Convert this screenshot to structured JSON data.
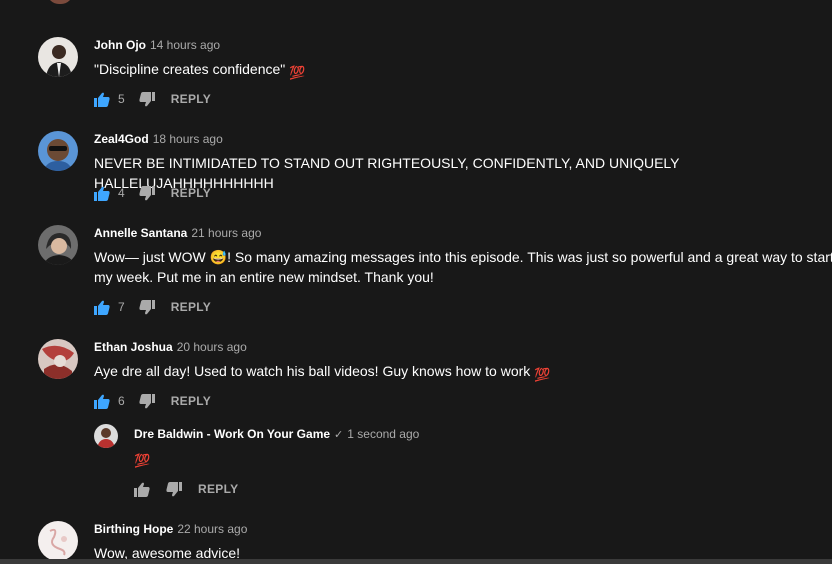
{
  "comments": [
    {
      "author": "John Ojo",
      "time": "14 hours ago",
      "text": "\"Discipline creates confidence\"",
      "emoji": "💯",
      "likes": "5",
      "reply_label": "REPLY"
    },
    {
      "author": "Zeal4God",
      "time": "18 hours ago",
      "text": "NEVER BE INTIMIDATED TO STAND OUT RIGHTEOUSLY, CONFIDENTLY, AND UNIQUELY HALLELUJAHHHHHHHHHH",
      "likes": "4",
      "reply_label": "REPLY"
    },
    {
      "author": "Annelle Santana",
      "time": "21 hours ago",
      "text_part1": "Wow— just WOW",
      "emoji": "😅",
      "text_part2": "! So many amazing messages into this episode. This was just so powerful and a great way to start",
      "text_line2": "my week. Put me in an entire new mindset. Thank you!",
      "likes": "7",
      "reply_label": "REPLY"
    },
    {
      "author": "Ethan Joshua",
      "time": "20 hours ago",
      "text": "Aye dre all day! Used to watch his ball videos! Guy knows how to work",
      "emoji": "💯",
      "likes": "6",
      "reply_label": "REPLY"
    },
    {
      "author": "Dre Baldwin - Work On Your Game",
      "verified": "✓",
      "time": "1 second ago",
      "emoji": "💯",
      "reply_label": "REPLY"
    },
    {
      "author": "Birthing Hope",
      "time": "22 hours ago",
      "text": "Wow, awesome advice!"
    }
  ],
  "colors": {
    "background": "#181818",
    "like_active": "#3ea6ff",
    "muted": "#aaaaaa"
  }
}
